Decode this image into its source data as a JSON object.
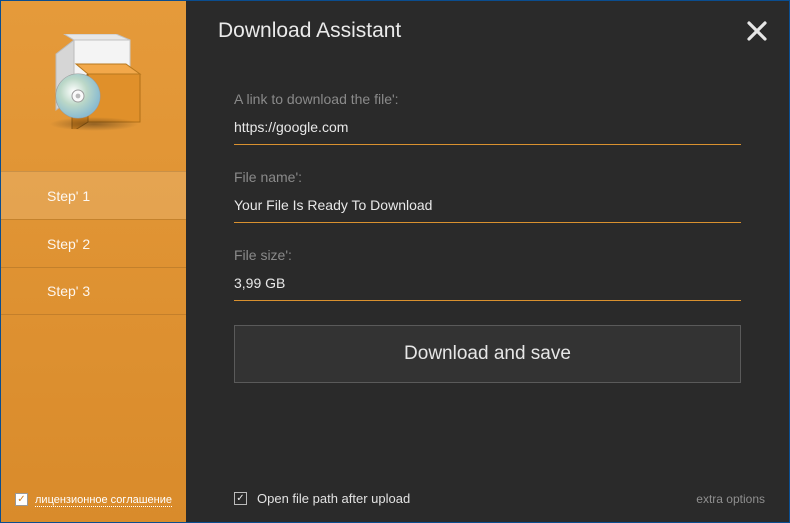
{
  "title": "Download Assistant",
  "sidebar": {
    "steps": [
      {
        "label": "Step' 1",
        "active": true
      },
      {
        "label": "Step' 2",
        "active": false
      },
      {
        "label": "Step' 3",
        "active": false
      }
    ],
    "license": {
      "checked": true,
      "text": "лицензионное соглашение"
    }
  },
  "form": {
    "link_label": "A link to download the file':",
    "link_value": "https://google.com",
    "name_label": "File name':",
    "name_value": "Your File Is Ready To Download",
    "size_label": "File size':",
    "size_value": "3,99 GB"
  },
  "download_button": "Download and save",
  "footer": {
    "open_path_checked": true,
    "open_path_label": "Open file path after upload",
    "extra_options": "extra options"
  },
  "icons": {
    "close": "✕",
    "check": "✓"
  }
}
